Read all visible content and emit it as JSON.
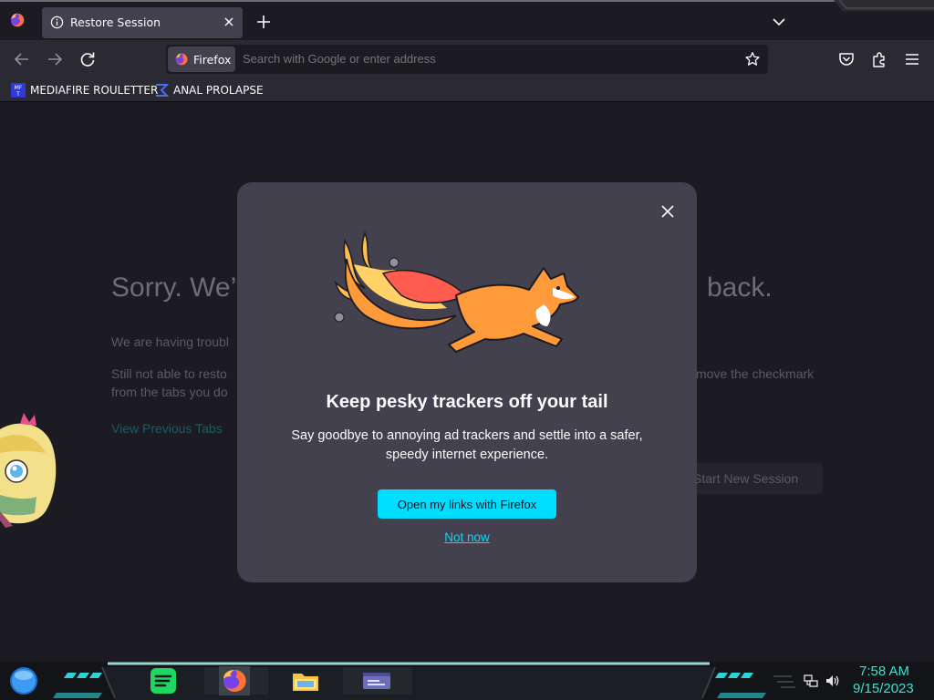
{
  "tabs": [
    {
      "title": "Restore Session"
    }
  ],
  "urlbar": {
    "identity_label": "Firefox",
    "placeholder": "Search with Google or enter address"
  },
  "bookmarks": [
    {
      "label": "MEDIAFIRE ROULETTER"
    },
    {
      "label": "ANAL PROLAPSE"
    }
  ],
  "background_page": {
    "title_start": "Sorry. We’",
    "title_end": "back.",
    "para1": "We are having troubl",
    "para2_start": "Still not able to resto",
    "para2_end": "move the checkmark",
    "para3": "from the tabs you do",
    "link": "View Previous Tabs",
    "button": "Start New Session"
  },
  "modal": {
    "title": "Keep pesky trackers off your tail",
    "body": "Say goodbye to annoying ad trackers and settle into a safer, speedy internet experience.",
    "primary_button": "Open my links with Firefox",
    "secondary_link": "Not now"
  },
  "taskbar": {
    "apps": [
      "spotify-icon",
      "firefox-icon",
      "file-explorer-icon",
      "app-window-icon"
    ],
    "time": "7:58 AM",
    "date": "9/15/2023"
  },
  "colors": {
    "accent": "#00ddff",
    "modal_bg": "#42414d",
    "page_bg": "#1c1b22",
    "clock": "#3ee0d0"
  }
}
